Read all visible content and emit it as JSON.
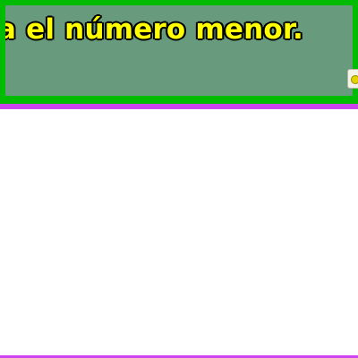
{
  "instruction": {
    "text": "ta el número menor."
  },
  "controls": {
    "play_icon": "round-button-icon"
  },
  "colors": {
    "panel_border": "#00bb00",
    "panel_fill": "#689a7d",
    "text_fill": "#ffff00",
    "text_outline": "#000000",
    "area_border": "#cc44ee",
    "area_fill": "#ffffff"
  }
}
